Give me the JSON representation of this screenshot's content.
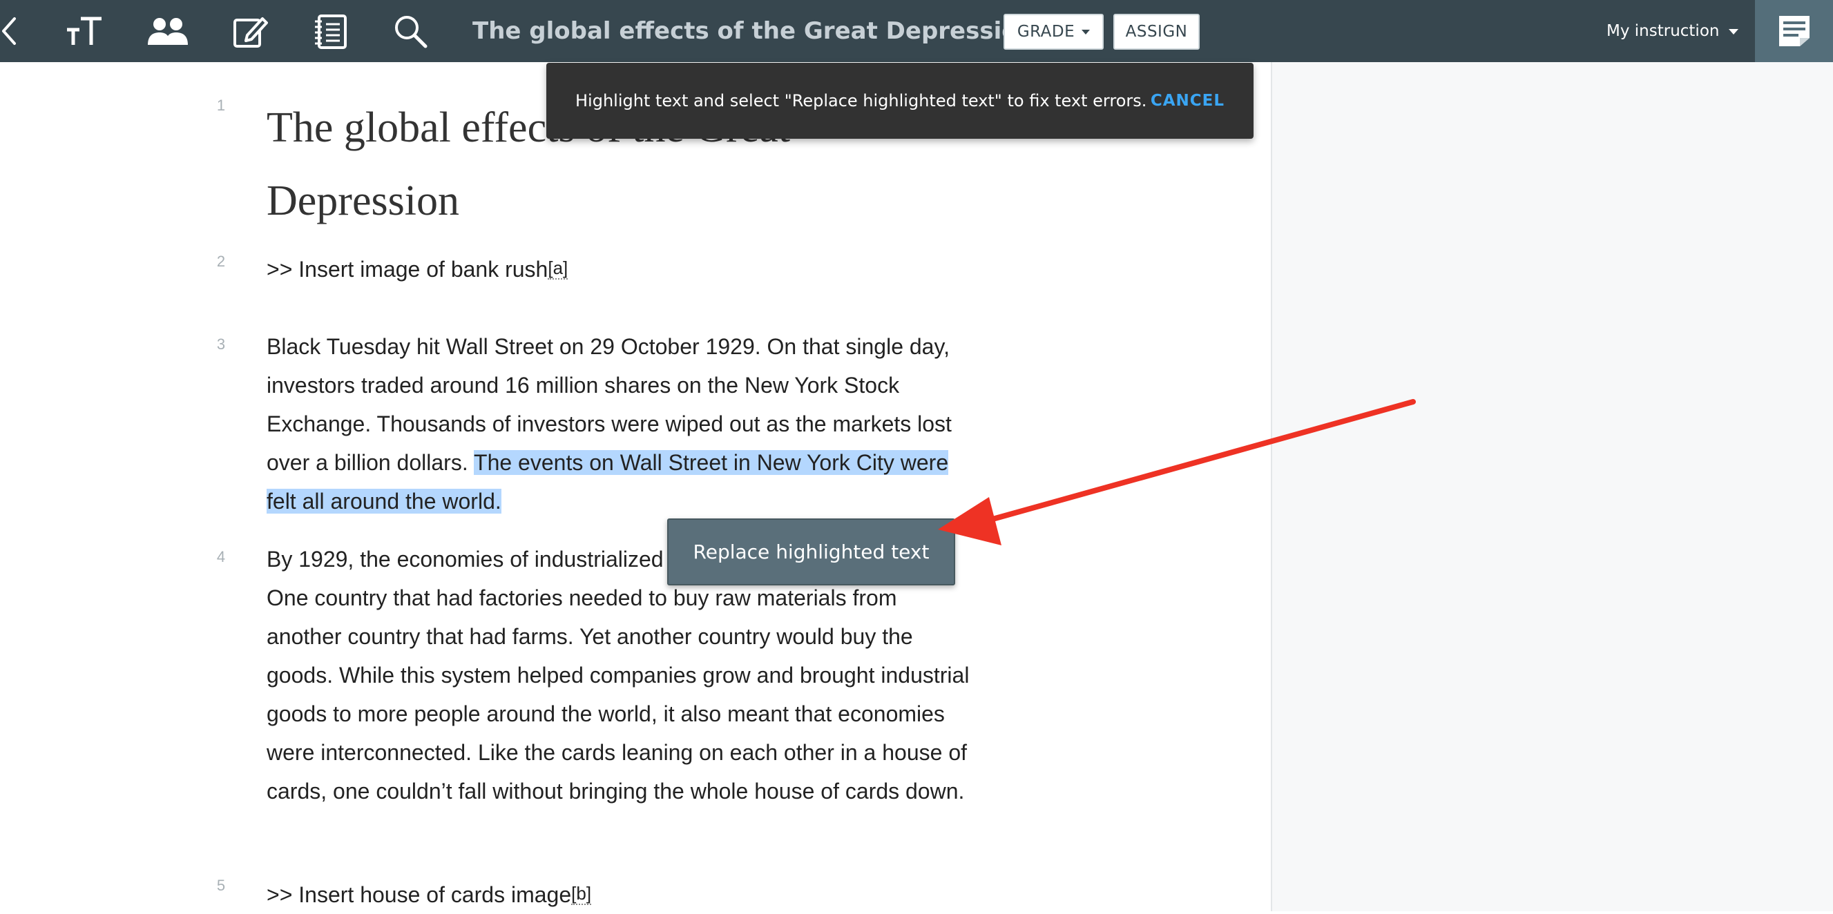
{
  "toolbar": {
    "icons": [
      "back-chevron-icon",
      "text-size-icon",
      "students-icon",
      "edit-icon",
      "notebook-icon",
      "search-icon"
    ],
    "title": "The global effects of the Great Depression",
    "grade_label": "GRADE",
    "assign_label": "ASSIGN",
    "instruction_label": "My instruction",
    "notes_icon": "notes-icon"
  },
  "toast": {
    "message": "Highlight text and select \"Replace highlighted text\" to fix text errors.",
    "cancel_label": "CANCEL"
  },
  "document": {
    "line_numbers": [
      "1",
      "2",
      "3",
      "4",
      "5"
    ],
    "heading": "The global effects of the Great Depression",
    "para2": {
      "text": ">> Insert image of bank rush",
      "footnote": "[a]"
    },
    "para3": {
      "before": "Black Tuesday hit Wall Street on 29 October 1929. On that single day, investors traded around 16 million shares on the New York Stock Exchange. Thousands of investors were wiped out as the markets lost over a billion dollars. ",
      "highlighted": "The events on Wall Street in New York City were felt all around the world."
    },
    "para4": {
      "text": "By 1929, the economies of industrialized countries were connected. One country that had factories needed to buy raw materials from another country that had farms. Yet another country would buy the goods. While this system helped companies grow and brought industrial goods to more people around the world, it also meant that economies were interconnected. Like the cards leaning on each other in a house of cards, one couldn’t fall without bringing the whole house of cards down."
    },
    "para5": {
      "text": ">> Insert house of cards image",
      "footnote": "[b]"
    }
  },
  "popup": {
    "replace_label": "Replace highlighted text"
  },
  "colors": {
    "topbar": "#37474f",
    "highlight": "#b4d7fe",
    "toast_bg": "#323232",
    "toast_action": "#3aa5f3",
    "annotation_arrow": "#ee3224"
  }
}
